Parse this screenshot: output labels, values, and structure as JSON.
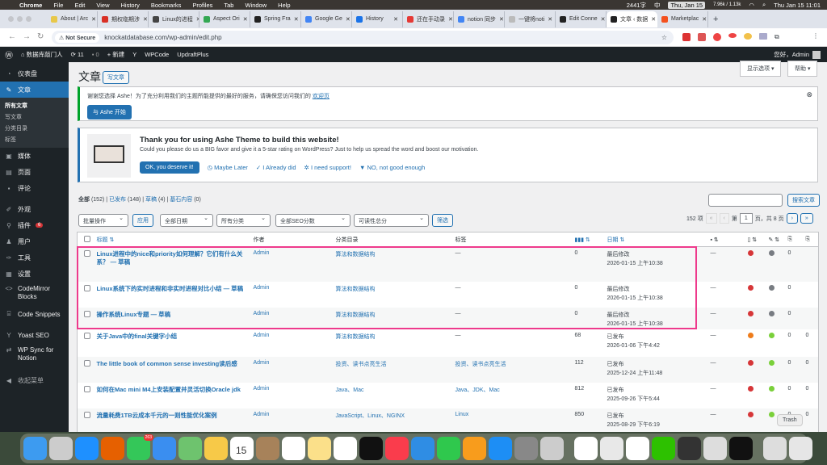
{
  "macbar": {
    "menus": [
      "Chrome",
      "File",
      "Edit",
      "View",
      "History",
      "Bookmarks",
      "Profiles",
      "Tab",
      "Window",
      "Help"
    ],
    "word_count": "2441字",
    "input": "中",
    "date_badge": "Thu, Jan 15",
    "net": "7.96k / 1.13k",
    "clock": "Thu Jan 15  11:01"
  },
  "tabs": [
    {
      "label": "About | Arc",
      "color": "#e8c84a"
    },
    {
      "label": "期权临期涉",
      "color": "#d93025"
    },
    {
      "label": "Linux的进程",
      "color": "#444"
    },
    {
      "label": "Aspect Ori",
      "color": "#34a853"
    },
    {
      "label": "Spring Fra",
      "color": "#222"
    },
    {
      "label": "Google Ge",
      "color": "#4285f4"
    },
    {
      "label": "History",
      "color": "#1a73e8"
    },
    {
      "label": "还在手动录",
      "color": "#e53935"
    },
    {
      "label": "notion 同步",
      "color": "#4285f4"
    },
    {
      "label": "一键将noti",
      "color": "#bbb"
    },
    {
      "label": "Edit Conne",
      "color": "#222"
    },
    {
      "label": "文章 ‹ 数据",
      "color": "#222",
      "active": true
    },
    {
      "label": "Marketplac",
      "color": "#f4511e"
    }
  ],
  "address": {
    "security": "Not Secure",
    "url": "knockatdatabase.com/wp-admin/edit.php"
  },
  "adminbar": {
    "site": "数据库敲门人",
    "updates": "11",
    "comments": "0",
    "new": "新建",
    "items": [
      "WPCode",
      "UpdraftPlus"
    ],
    "greeting": "您好，Admin"
  },
  "sidebar": {
    "items": [
      {
        "label": "仪表盘",
        "icon": "dashboard-icon"
      },
      {
        "label": "文章",
        "icon": "pin-icon",
        "current": true
      },
      {
        "label": "媒体",
        "icon": "media-icon"
      },
      {
        "label": "页面",
        "icon": "page-icon"
      },
      {
        "label": "评论",
        "icon": "comment-icon"
      },
      {
        "label": "外观",
        "icon": "appearance-icon"
      },
      {
        "label": "插件",
        "icon": "plugin-icon",
        "badge": "6"
      },
      {
        "label": "用户",
        "icon": "user-icon"
      },
      {
        "label": "工具",
        "icon": "wrench-icon"
      },
      {
        "label": "设置",
        "icon": "settings-icon"
      },
      {
        "label": "CodeMirror Blocks",
        "icon": "code-icon"
      },
      {
        "label": "Code Snippets",
        "icon": "snippet-icon"
      },
      {
        "label": "Yoast SEO",
        "icon": "yoast-icon"
      },
      {
        "label": "WP Sync for Notion",
        "icon": "sync-icon"
      },
      {
        "label": "收起菜单",
        "icon": "collapse-icon"
      }
    ],
    "submenu": [
      "所有文章",
      "写文章",
      "分类目录",
      "标签"
    ]
  },
  "page": {
    "title": "文章",
    "add_new": "写文章",
    "screen_options": "显示选项 ▾",
    "help": "帮助 ▾"
  },
  "notice1": {
    "text": "谢谢您选择 Ashe！为了充分利用我们的主题所能提供的最好的服务，请确保您访问我们的",
    "link": "欢迎页",
    "button": "与 Ashe 开始"
  },
  "notice2": {
    "title": "Thank you for using Ashe Theme to build this website!",
    "text": "Could you please do us a BIG favor and give it a 5-star rating on WordPress? Just to help us spread the word and boost our motivation.",
    "ok": "OK, you deserve it!",
    "later": "Maybe Later",
    "did": "I Already did",
    "support": "I need support!",
    "no": "NO, not good enough"
  },
  "filters": {
    "all": "全部",
    "all_count": "(152)",
    "published": "已发布",
    "published_count": "(148)",
    "draft": "草稿",
    "draft_count": "(4)",
    "cornerstone": "基石内容",
    "cornerstone_count": "(0)",
    "bulk": "批量操作",
    "apply": "应用",
    "dates": "全部日期",
    "cats": "所有分类",
    "seo": "全部SEO分数",
    "readability": "可读性总分",
    "filter": "筛选",
    "search_btn": "搜索文章",
    "search_value": "",
    "items": "152 项",
    "page_prefix": "第",
    "page": "1",
    "page_suffix": "页，共 8 页"
  },
  "columns": {
    "title": "标题",
    "author": "作者",
    "category": "分类目录",
    "tags": "标签",
    "date": "日期"
  },
  "posts": [
    {
      "title": "Linux进程中的nice和priority如何理解？它们有什么关系？ — 草稿",
      "author": "Admin",
      "category": "算法和数据结构",
      "tags": "—",
      "views": "0",
      "status": "最后修改",
      "date": "2026-01-15 上午10:38",
      "comments": "—",
      "seo": "#d63638",
      "read": "#787c82",
      "c1": "0",
      "c2": ""
    },
    {
      "title": "Linux系统下的实时进程和非实时进程对比小结 — 草稿",
      "author": "Admin",
      "category": "算法和数据结构",
      "tags": "—",
      "views": "0",
      "status": "最后修改",
      "date": "2026-01-15 上午10:38",
      "comments": "—",
      "seo": "#d63638",
      "read": "#787c82",
      "c1": "0",
      "c2": ""
    },
    {
      "title": "操作系统Linux专题 — 草稿",
      "author": "Admin",
      "category": "算法和数据结构",
      "tags": "—",
      "views": "0",
      "status": "最后修改",
      "date": "2026-01-15 上午10:38",
      "comments": "—",
      "seo": "#d63638",
      "read": "#787c82",
      "c1": "0",
      "c2": ""
    },
    {
      "title": "关于Java中的final关键字小结",
      "author": "Admin",
      "category": "算法和数据结构",
      "tags": "—",
      "views": "68",
      "status": "已发布",
      "date": "2026-01-06 下午4:42",
      "comments": "—",
      "seo": "#ee7c1b",
      "read": "#7ad03a",
      "c1": "0",
      "c2": "0"
    },
    {
      "title": "The little book of common sense investing读后感",
      "author": "Admin",
      "category": "投资、读书点亮生活",
      "tags": "投资、读书点亮生活",
      "views": "112",
      "status": "已发布",
      "date": "2025-12-24 上午11:48",
      "comments": "—",
      "seo": "#d63638",
      "read": "#7ad03a",
      "c1": "0",
      "c2": "0"
    },
    {
      "title": "如何在Mac mini M4上安装配置并灵活切换Oracle jdk",
      "author": "Admin",
      "category": "Java、Mac",
      "tags": "Java、JDK、Mac",
      "views": "812",
      "status": "已发布",
      "date": "2025-09-26 下午5:44",
      "comments": "—",
      "seo": "#d63638",
      "read": "#7ad03a",
      "c1": "0",
      "c2": "0"
    },
    {
      "title": "流量耗费1TB云成本千元的一则性能优化案例",
      "author": "Admin",
      "category": "JavaScript、Linux、NGINX",
      "tags": "Linux",
      "views": "850",
      "status": "已发布",
      "date": "2025-08-29 下午6:19",
      "comments": "—",
      "seo": "#d63638",
      "read": "#7ad03a",
      "c1": "0",
      "c2": "0"
    }
  ],
  "tooltip": "Trash",
  "dock": {
    "apps": [
      {
        "name": "finder",
        "color": "#3d9bf0"
      },
      {
        "name": "launchpad",
        "color": "#ccc"
      },
      {
        "name": "safari",
        "color": "#1e90ff"
      },
      {
        "name": "firefox",
        "color": "#e66000"
      },
      {
        "name": "messages",
        "color": "#34c759",
        "badge": "263"
      },
      {
        "name": "mail",
        "color": "#3a8ef0"
      },
      {
        "name": "maps",
        "color": "#6ec36e"
      },
      {
        "name": "photos",
        "color": "#f7c948"
      },
      {
        "name": "calendar",
        "color": "#fff",
        "label": "15"
      },
      {
        "name": "contacts",
        "color": "#a7825a"
      },
      {
        "name": "reminders",
        "color": "#fff"
      },
      {
        "name": "notes",
        "color": "#fbe08a"
      },
      {
        "name": "freeform",
        "color": "#fff"
      },
      {
        "name": "appletv",
        "color": "#111"
      },
      {
        "name": "music",
        "color": "#fa3c4c"
      },
      {
        "name": "keynote",
        "color": "#2f8de4"
      },
      {
        "name": "numbers",
        "color": "#2fc84d"
      },
      {
        "name": "pages",
        "color": "#f89c1c"
      },
      {
        "name": "appstore",
        "color": "#1d8ef5"
      },
      {
        "name": "settings",
        "color": "#888"
      },
      {
        "name": "iphone-mirroring",
        "color": "#ccc"
      },
      {
        "name": "notion",
        "color": "#fff"
      },
      {
        "name": "chrome",
        "color": "#e8e8e8"
      },
      {
        "name": "app",
        "color": "#fff"
      },
      {
        "name": "wechat",
        "color": "#2dc100"
      },
      {
        "name": "sublime",
        "color": "#333"
      },
      {
        "name": "preview",
        "color": "#ddd"
      },
      {
        "name": "terminal",
        "color": "#111"
      },
      {
        "name": "downloads",
        "color": "#ddd"
      },
      {
        "name": "trash",
        "color": "#e6e6e6"
      }
    ]
  }
}
